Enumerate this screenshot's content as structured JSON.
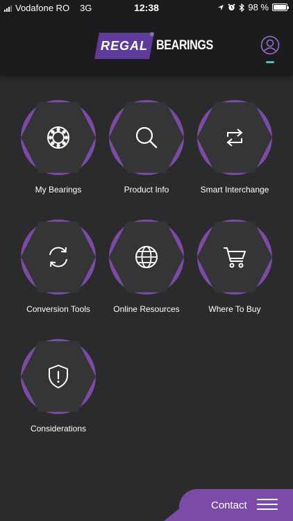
{
  "status_bar": {
    "carrier": "Vodafone RO",
    "network": "3G",
    "time": "12:38",
    "battery": "98 %",
    "battery_level": 0.98
  },
  "header": {
    "logo_badge": "REGAL",
    "logo_text": "BEARINGS",
    "profile_icon": "user-profile-icon",
    "accent_color": "#7c4ba5",
    "indicator_color": "#4fc3c3"
  },
  "tiles": [
    {
      "label": "My Bearings",
      "icon": "bearing-icon"
    },
    {
      "label": "Product Info",
      "icon": "search-icon"
    },
    {
      "label": "Smart Interchange",
      "icon": "interchange-arrows-icon"
    },
    {
      "label": "Conversion Tools",
      "icon": "refresh-icon"
    },
    {
      "label": "Online Resources",
      "icon": "globe-icon"
    },
    {
      "label": "Where To Buy",
      "icon": "shopping-cart-icon"
    },
    {
      "label": "Considerations",
      "icon": "shield-alert-icon"
    }
  ],
  "footer": {
    "contact_label": "Contact",
    "menu_icon": "hamburger-menu-icon"
  }
}
